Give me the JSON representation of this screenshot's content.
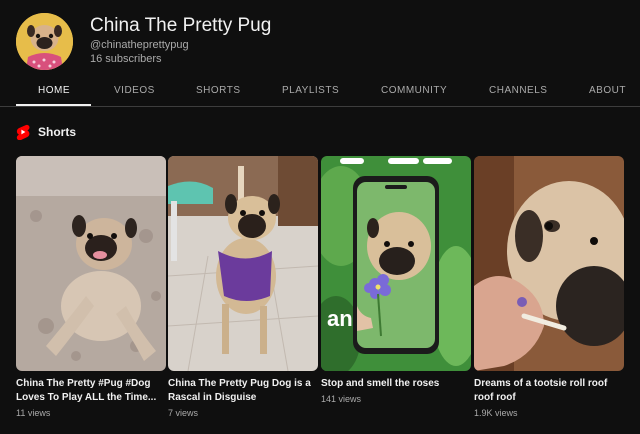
{
  "channel": {
    "name": "China The Pretty Pug",
    "handle": "@chinatheprettypug",
    "subscribers": "16 subscribers"
  },
  "tabs": [
    {
      "label": "HOME",
      "active": true
    },
    {
      "label": "VIDEOS"
    },
    {
      "label": "SHORTS"
    },
    {
      "label": "PLAYLISTS"
    },
    {
      "label": "COMMUNITY"
    },
    {
      "label": "CHANNELS"
    },
    {
      "label": "ABOUT"
    }
  ],
  "shorts_section": {
    "title": "Shorts",
    "icon": "youtube-shorts-icon",
    "accent": "#ff0000"
  },
  "shorts": [
    {
      "title": "China The Pretty #Pug #Dog Loves To Play ALL the Time...",
      "views": "11 views"
    },
    {
      "title": "China The Pretty Pug Dog is a Rascal in Disguise",
      "views": "7 views"
    },
    {
      "title": "Stop and smell the roses",
      "views": "141 views",
      "overlay_text": "an"
    },
    {
      "title": "Dreams of a tootsie roll roof roof roof",
      "views": "1.9K views"
    }
  ],
  "colors": {
    "background": "#0f0f0f",
    "text_primary": "#f1f1f1",
    "text_secondary": "#aaaaaa"
  }
}
